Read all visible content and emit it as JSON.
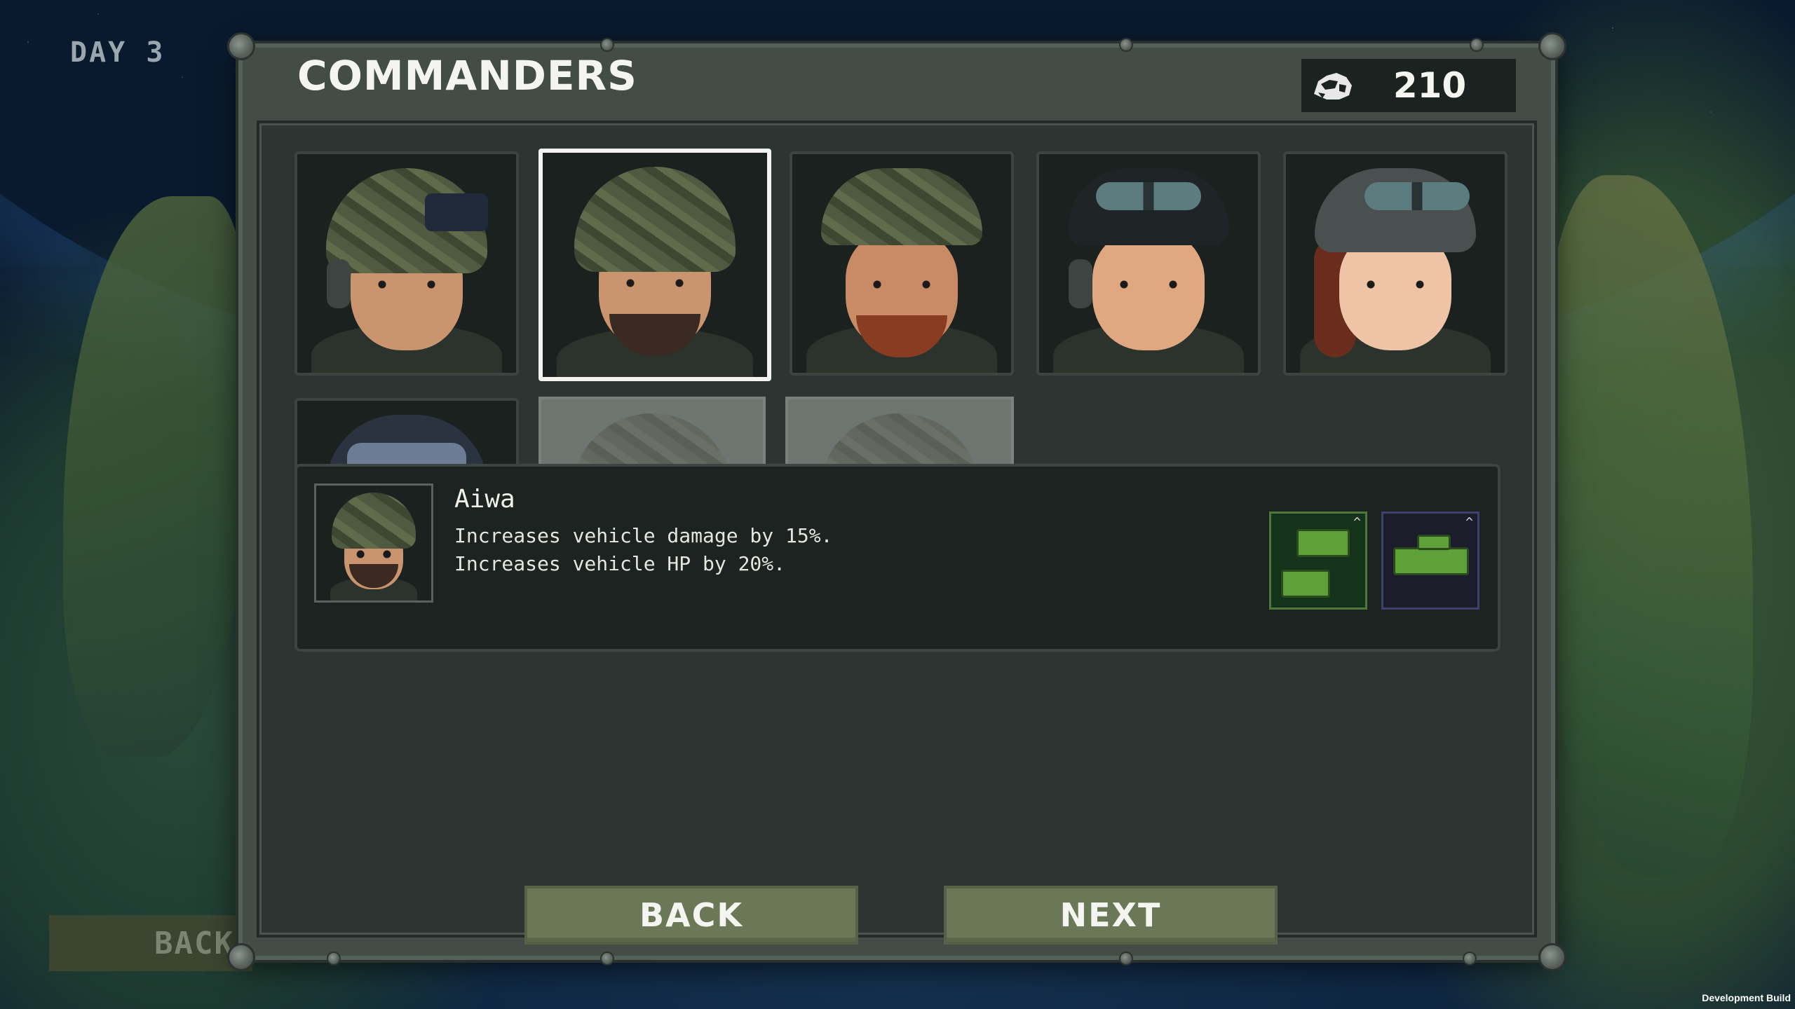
{
  "hud": {
    "day_label": "DAY 3",
    "back_label": "BACK",
    "dev_build": "Development Build"
  },
  "panel": {
    "title": "COMMANDERS",
    "currency": {
      "icon": "scrap-icon",
      "value": "210"
    }
  },
  "commanders": [
    {
      "id": "commander-1",
      "state": "unlocked",
      "selected": false
    },
    {
      "id": "commander-2",
      "state": "unlocked",
      "selected": true
    },
    {
      "id": "commander-3",
      "state": "unlocked",
      "selected": false
    },
    {
      "id": "commander-4",
      "state": "unlocked",
      "selected": false
    },
    {
      "id": "commander-5",
      "state": "unlocked",
      "selected": false
    },
    {
      "id": "commander-6",
      "state": "unlocked",
      "selected": false
    },
    {
      "id": "commander-7",
      "state": "locked",
      "selected": false
    },
    {
      "id": "commander-8",
      "state": "locked",
      "selected": false
    }
  ],
  "selected_info": {
    "name": "Aiwa",
    "lines": [
      "Increases vehicle damage by 15%.",
      "Increases vehicle HP by 20%."
    ],
    "units": [
      {
        "icon": "jeep-squad-icon",
        "accent": "#4d7a3a"
      },
      {
        "icon": "tank-icon",
        "accent": "#3f4371"
      }
    ]
  },
  "buttons": {
    "back": "BACK",
    "next": "NEXT"
  },
  "colors": {
    "panel": "#434c47",
    "button": "#6a7858",
    "selected_border": "#f2f2f0"
  }
}
